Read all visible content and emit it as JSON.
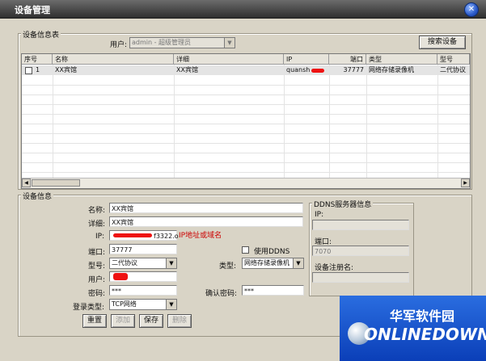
{
  "window": {
    "title": "设备管理",
    "close_glyph": "✕"
  },
  "device_list": {
    "group_title": "设备信息表",
    "user_label": "用户:",
    "user_value": "admin - 超级管理员",
    "search_button": "搜索设备",
    "columns": [
      "序号",
      "名称",
      "详细",
      "IP",
      "端口",
      "类型",
      "型号"
    ],
    "rows": [
      {
        "index": "1",
        "name": "XX宾馆",
        "detail": "XX宾馆",
        "ip": "quansh",
        "port": "37777",
        "type": "网络存储录像机",
        "model": "二代协议"
      }
    ]
  },
  "device_info": {
    "group_title": "设备信息",
    "name_label": "名称:",
    "name_value": "XX宾馆",
    "detail_label": "详细:",
    "detail_value": "XX宾馆",
    "ip_label": "IP:",
    "ip_value": "f3322.o",
    "ip_hint": "IP地址或域名",
    "port_label": "端口:",
    "port_value": "37777",
    "ddns_checkbox_label": "使用DDNS",
    "model_label": "型号:",
    "model_value": "二代协议",
    "type_label": "类型:",
    "type_value": "网络存储录像机",
    "user_label": "用户:",
    "password_label": "密码:",
    "password_value": "***",
    "confirm_password_label": "确认密码:",
    "confirm_password_value": "***",
    "login_type_label": "登录类型:",
    "login_type_value": "TCP网络"
  },
  "ddns": {
    "group_title": "DDNS服务器信息",
    "ip_label": "IP:",
    "port_label": "端口:",
    "port_value": "7070",
    "device_name_label": "设备注册名:"
  },
  "buttons": {
    "reset": "重置",
    "add": "添加",
    "save": "保存",
    "delete": "删除"
  },
  "logo": {
    "cn": "华军软件园",
    "en": "ONLINEDOWN"
  }
}
